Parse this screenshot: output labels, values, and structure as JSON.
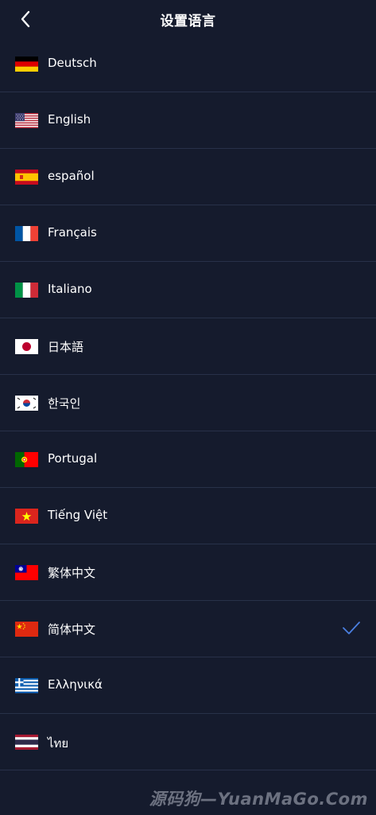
{
  "header": {
    "title": "设置语言",
    "back_icon": "chevron-left-icon"
  },
  "languages": [
    {
      "label": "Deutsch",
      "flag": "germany-flag-icon",
      "selected": false
    },
    {
      "label": "English",
      "flag": "usa-flag-icon",
      "selected": false
    },
    {
      "label": "español",
      "flag": "spain-flag-icon",
      "selected": false
    },
    {
      "label": "Français",
      "flag": "france-flag-icon",
      "selected": false
    },
    {
      "label": "Italiano",
      "flag": "italy-flag-icon",
      "selected": false
    },
    {
      "label": "日本語",
      "flag": "japan-flag-icon",
      "selected": false
    },
    {
      "label": "한국인",
      "flag": "south-korea-flag-icon",
      "selected": false
    },
    {
      "label": "Portugal",
      "flag": "portugal-flag-icon",
      "selected": false
    },
    {
      "label": "Tiếng Việt",
      "flag": "vietnam-flag-icon",
      "selected": false
    },
    {
      "label": "繁体中文",
      "flag": "taiwan-flag-icon",
      "selected": false
    },
    {
      "label": "简体中文",
      "flag": "china-flag-icon",
      "selected": true
    },
    {
      "label": "Ελληνικά",
      "flag": "greece-flag-icon",
      "selected": false
    },
    {
      "label": "ไทย",
      "flag": "thailand-flag-icon",
      "selected": false
    }
  ],
  "watermark": "源码狗—YuanMaGo.Com",
  "colors": {
    "background": "#151b2d",
    "divider": "#283149",
    "check": "#4a7fe0",
    "text": "#ffffff"
  }
}
